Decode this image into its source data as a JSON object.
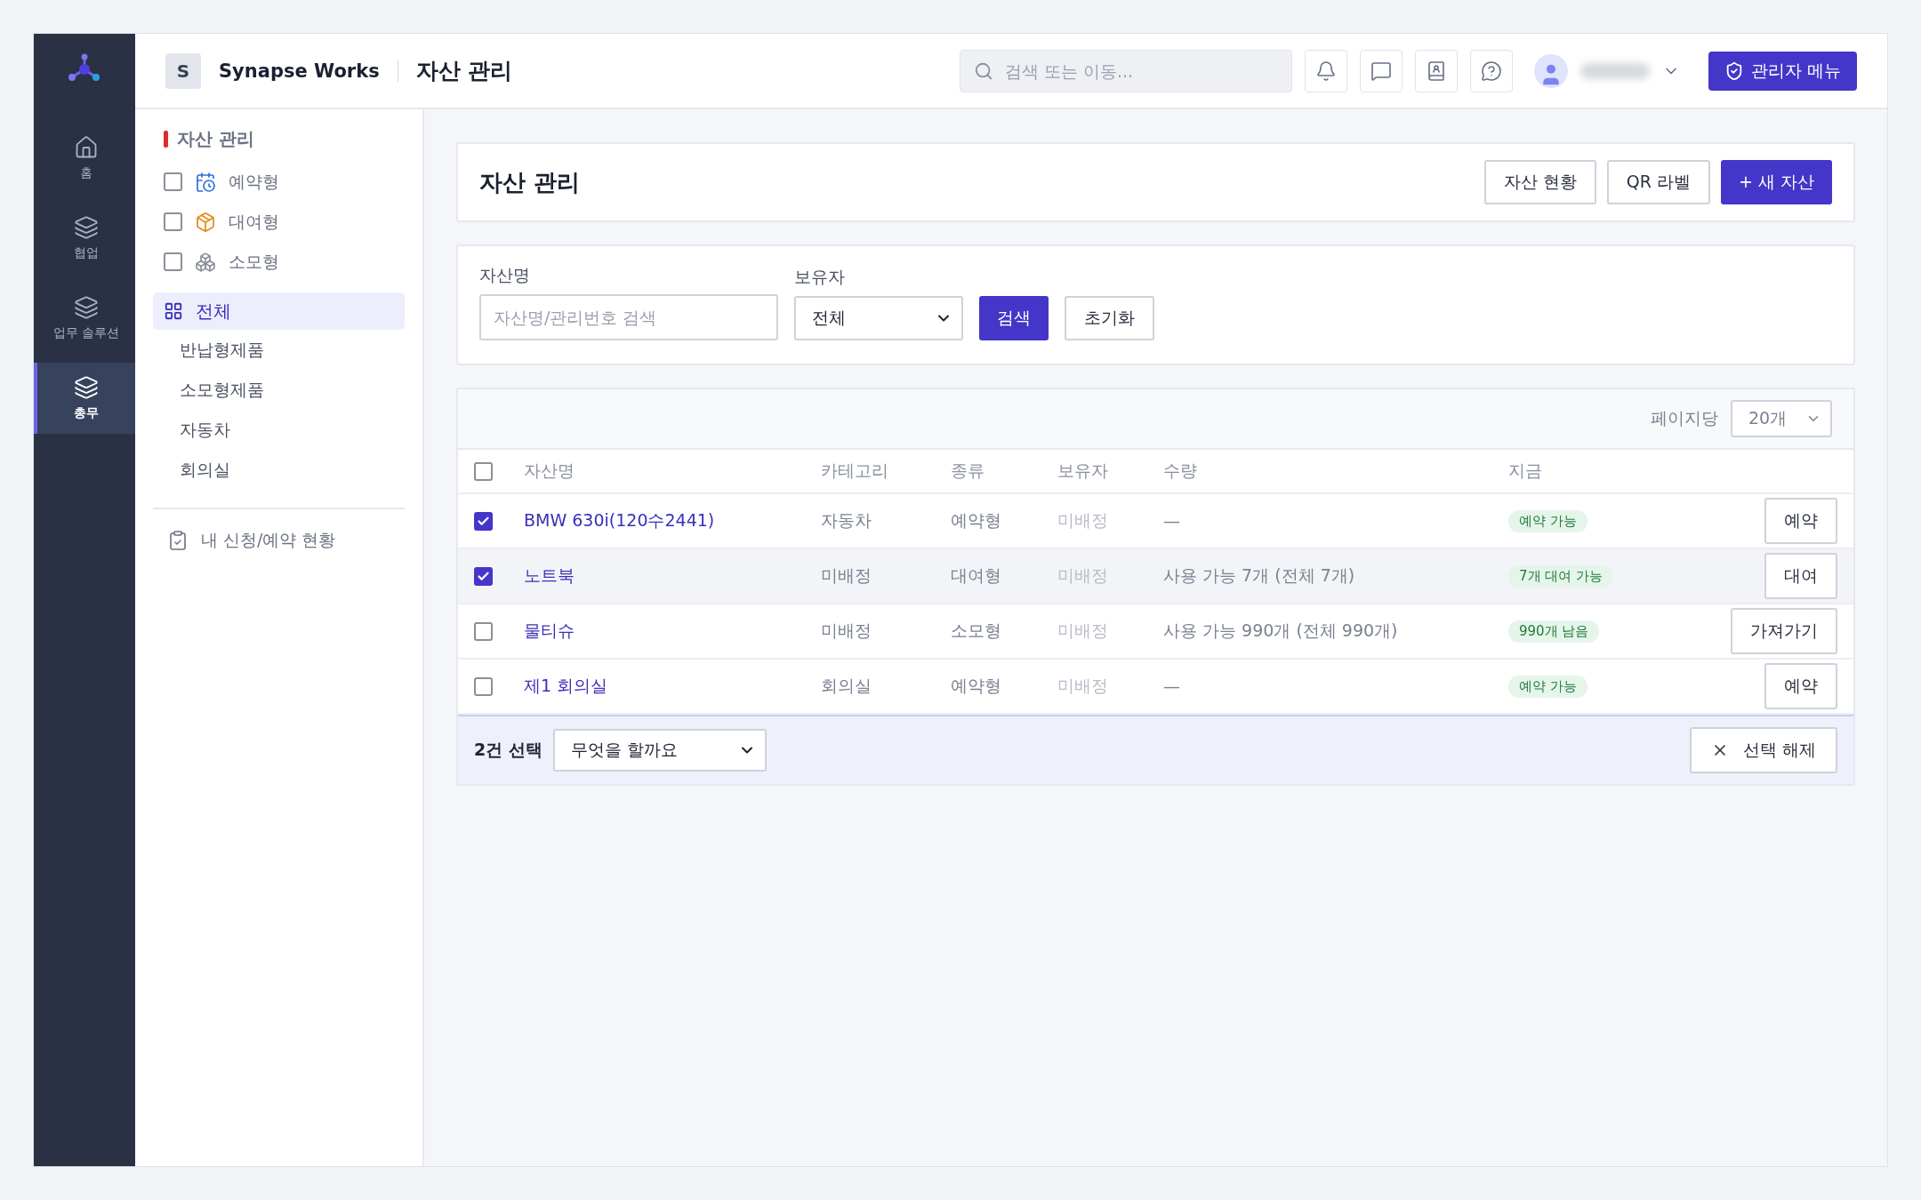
{
  "rail": {
    "items": [
      {
        "label": "홈",
        "kind": "home",
        "selected": false
      },
      {
        "label": "협업",
        "kind": "layers",
        "selected": false
      },
      {
        "label": "업무 솔루션",
        "kind": "layers",
        "selected": false
      },
      {
        "label": "총무",
        "kind": "layers",
        "selected": true
      }
    ]
  },
  "topbar": {
    "brand_initial": "S",
    "brand": "Synapse Works",
    "page_title": "자산 관리",
    "search": {
      "placeholder": "검색 또는 이동..."
    },
    "admin_button": "관리자 메뉴"
  },
  "sidebar": {
    "section_title": "자산 관리",
    "filters": [
      {
        "label": "예약형",
        "kind": "calendar",
        "checked": false
      },
      {
        "label": "대여형",
        "kind": "box",
        "checked": false
      },
      {
        "label": "소모형",
        "kind": "cubes",
        "checked": false
      }
    ],
    "nav": [
      {
        "label": "전체",
        "selected": true,
        "children": [
          {
            "label": "반납형제품",
            "selected": false
          },
          {
            "label": "소모형제품",
            "selected": false
          },
          {
            "label": "자동차",
            "selected": false
          },
          {
            "label": "회의실",
            "selected": false
          }
        ]
      }
    ],
    "footer_link": "내 신청/예약 현황"
  },
  "page_header": {
    "title": "자산 관리",
    "buttons": [
      {
        "label": "자산 현황",
        "kind": "outline"
      },
      {
        "label": "QR 라벨",
        "kind": "outline"
      },
      {
        "label": "+ 새 자산",
        "kind": "primary"
      }
    ]
  },
  "filter": {
    "name_label": "자산명",
    "name_placeholder": "자산명/관리번호 검색",
    "owner_label": "보유자",
    "owner_value": "전체",
    "search_button": "검색",
    "reset_button": "초기화"
  },
  "table": {
    "per_page_label": "페이지당",
    "per_page_value": "20개",
    "all_checked": false,
    "columns": [
      "자산명",
      "카테고리",
      "종류",
      "보유자",
      "수량",
      "지금"
    ],
    "rows": [
      {
        "checked": true,
        "hovered": false,
        "name": "BMW 630i(120수2441)",
        "category": "자동차",
        "type": "예약형",
        "owner": "미배정",
        "quantity": "—",
        "status": "예약 가능",
        "action": "예약"
      },
      {
        "checked": true,
        "hovered": true,
        "name": "노트북",
        "category": "미배정",
        "type": "대여형",
        "owner": "미배정",
        "quantity": "사용 가능 7개 (전체 7개)",
        "status": "7개 대여 가능",
        "action": "대여"
      },
      {
        "checked": false,
        "hovered": false,
        "name": "물티슈",
        "category": "미배정",
        "type": "소모형",
        "owner": "미배정",
        "quantity": "사용 가능 990개 (전체 990개)",
        "status": "990개 남음",
        "action": "가져가기"
      },
      {
        "checked": false,
        "hovered": false,
        "name": "제1 회의실",
        "category": "회의실",
        "type": "예약형",
        "owner": "미배정",
        "quantity": "—",
        "status": "예약 가능",
        "action": "예약"
      }
    ]
  },
  "bulk_bar": {
    "count": "2건 선택",
    "action_placeholder": "무엇을 할까요",
    "clear_button": "선택 해제"
  }
}
